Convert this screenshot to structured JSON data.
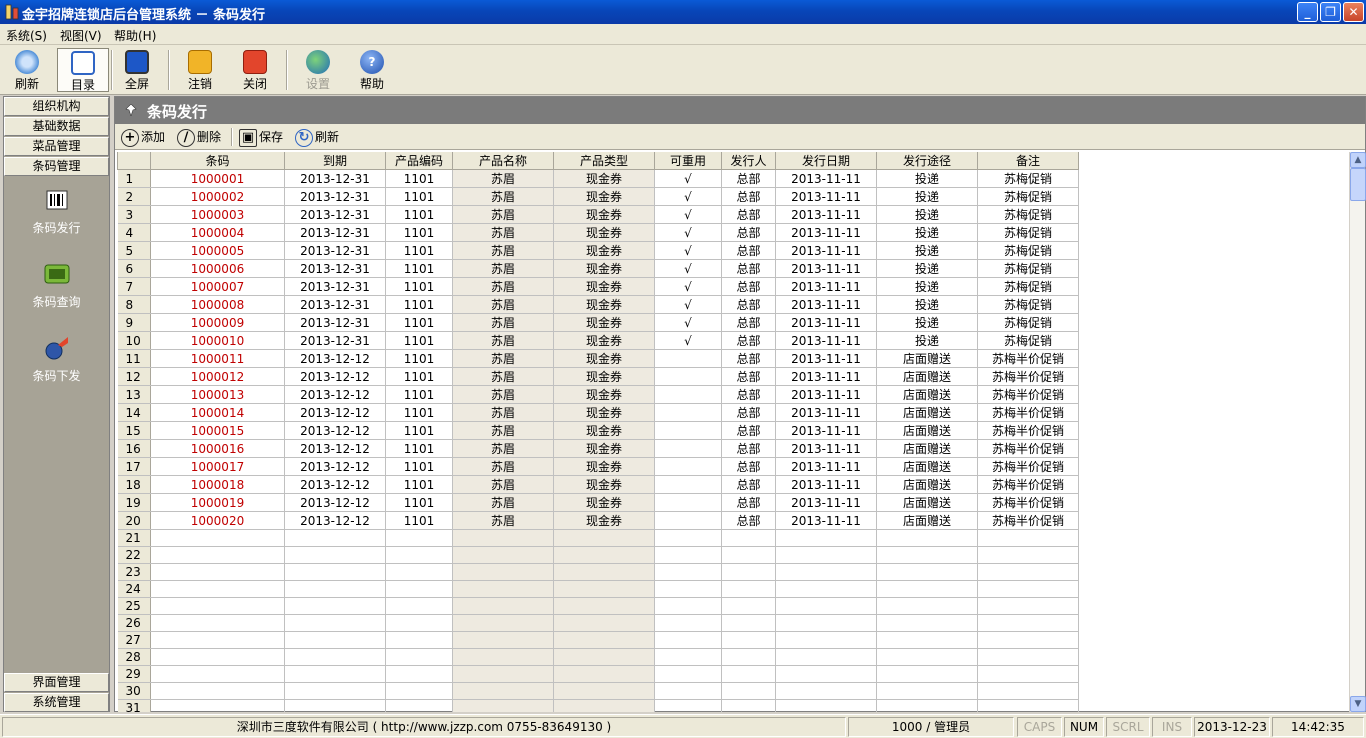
{
  "window": {
    "title": "金宇招牌连锁店后台管理系统 － 条码发行"
  },
  "menu": [
    "系统(S)",
    "视图(V)",
    "帮助(H)"
  ],
  "toolbar": {
    "refresh": "刷新",
    "directory": "目录",
    "fullscreen": "全屏",
    "logout": "注销",
    "close": "关闭",
    "settings": "设置",
    "help": "帮助"
  },
  "nav": {
    "sections_top": [
      "组织机构",
      "基础数据",
      "菜品管理",
      "条码管理"
    ],
    "items": [
      "条码发行",
      "条码查询",
      "条码下发"
    ],
    "sections_bottom": [
      "界面管理",
      "系统管理"
    ]
  },
  "panel": {
    "title": "条码发行"
  },
  "actions": {
    "add": "添加",
    "delete": "删除",
    "save": "保存",
    "refresh": "刷新"
  },
  "grid": {
    "columns": [
      "条码",
      "到期",
      "产品编码",
      "产品名称",
      "产品类型",
      "可重用",
      "发行人",
      "发行日期",
      "发行途径",
      "备注"
    ],
    "rows": [
      [
        "1000001",
        "2013-12-31",
        "1101",
        "苏眉",
        "现金券",
        "√",
        "总部",
        "2013-11-11",
        "投递",
        "苏梅促销"
      ],
      [
        "1000002",
        "2013-12-31",
        "1101",
        "苏眉",
        "现金券",
        "√",
        "总部",
        "2013-11-11",
        "投递",
        "苏梅促销"
      ],
      [
        "1000003",
        "2013-12-31",
        "1101",
        "苏眉",
        "现金券",
        "√",
        "总部",
        "2013-11-11",
        "投递",
        "苏梅促销"
      ],
      [
        "1000004",
        "2013-12-31",
        "1101",
        "苏眉",
        "现金券",
        "√",
        "总部",
        "2013-11-11",
        "投递",
        "苏梅促销"
      ],
      [
        "1000005",
        "2013-12-31",
        "1101",
        "苏眉",
        "现金券",
        "√",
        "总部",
        "2013-11-11",
        "投递",
        "苏梅促销"
      ],
      [
        "1000006",
        "2013-12-31",
        "1101",
        "苏眉",
        "现金券",
        "√",
        "总部",
        "2013-11-11",
        "投递",
        "苏梅促销"
      ],
      [
        "1000007",
        "2013-12-31",
        "1101",
        "苏眉",
        "现金券",
        "√",
        "总部",
        "2013-11-11",
        "投递",
        "苏梅促销"
      ],
      [
        "1000008",
        "2013-12-31",
        "1101",
        "苏眉",
        "现金券",
        "√",
        "总部",
        "2013-11-11",
        "投递",
        "苏梅促销"
      ],
      [
        "1000009",
        "2013-12-31",
        "1101",
        "苏眉",
        "现金券",
        "√",
        "总部",
        "2013-11-11",
        "投递",
        "苏梅促销"
      ],
      [
        "1000010",
        "2013-12-31",
        "1101",
        "苏眉",
        "现金券",
        "√",
        "总部",
        "2013-11-11",
        "投递",
        "苏梅促销"
      ],
      [
        "1000011",
        "2013-12-12",
        "1101",
        "苏眉",
        "现金券",
        "",
        "总部",
        "2013-11-11",
        "店面赠送",
        "苏梅半价促销"
      ],
      [
        "1000012",
        "2013-12-12",
        "1101",
        "苏眉",
        "现金券",
        "",
        "总部",
        "2013-11-11",
        "店面赠送",
        "苏梅半价促销"
      ],
      [
        "1000013",
        "2013-12-12",
        "1101",
        "苏眉",
        "现金券",
        "",
        "总部",
        "2013-11-11",
        "店面赠送",
        "苏梅半价促销"
      ],
      [
        "1000014",
        "2013-12-12",
        "1101",
        "苏眉",
        "现金券",
        "",
        "总部",
        "2013-11-11",
        "店面赠送",
        "苏梅半价促销"
      ],
      [
        "1000015",
        "2013-12-12",
        "1101",
        "苏眉",
        "现金券",
        "",
        "总部",
        "2013-11-11",
        "店面赠送",
        "苏梅半价促销"
      ],
      [
        "1000016",
        "2013-12-12",
        "1101",
        "苏眉",
        "现金券",
        "",
        "总部",
        "2013-11-11",
        "店面赠送",
        "苏梅半价促销"
      ],
      [
        "1000017",
        "2013-12-12",
        "1101",
        "苏眉",
        "现金券",
        "",
        "总部",
        "2013-11-11",
        "店面赠送",
        "苏梅半价促销"
      ],
      [
        "1000018",
        "2013-12-12",
        "1101",
        "苏眉",
        "现金券",
        "",
        "总部",
        "2013-11-11",
        "店面赠送",
        "苏梅半价促销"
      ],
      [
        "1000019",
        "2013-12-12",
        "1101",
        "苏眉",
        "现金券",
        "",
        "总部",
        "2013-11-11",
        "店面赠送",
        "苏梅半价促销"
      ],
      [
        "1000020",
        "2013-12-12",
        "1101",
        "苏眉",
        "现金券",
        "",
        "总部",
        "2013-11-11",
        "店面赠送",
        "苏梅半价促销"
      ]
    ],
    "total_rows": 32
  },
  "status": {
    "company": "深圳市三度软件有限公司 ( http://www.jzzp.com  0755-83649130 )",
    "user": "1000 / 管理员",
    "caps": "CAPS",
    "num": "NUM",
    "scrl": "SCRL",
    "ins": "INS",
    "date": "2013-12-23",
    "time": "14:42:35"
  },
  "colors": {
    "title_bar": "#0a4fcb",
    "panel_header": "#7b7b7b",
    "code_text": "#c00000",
    "nav_bg": "#a7a396"
  }
}
